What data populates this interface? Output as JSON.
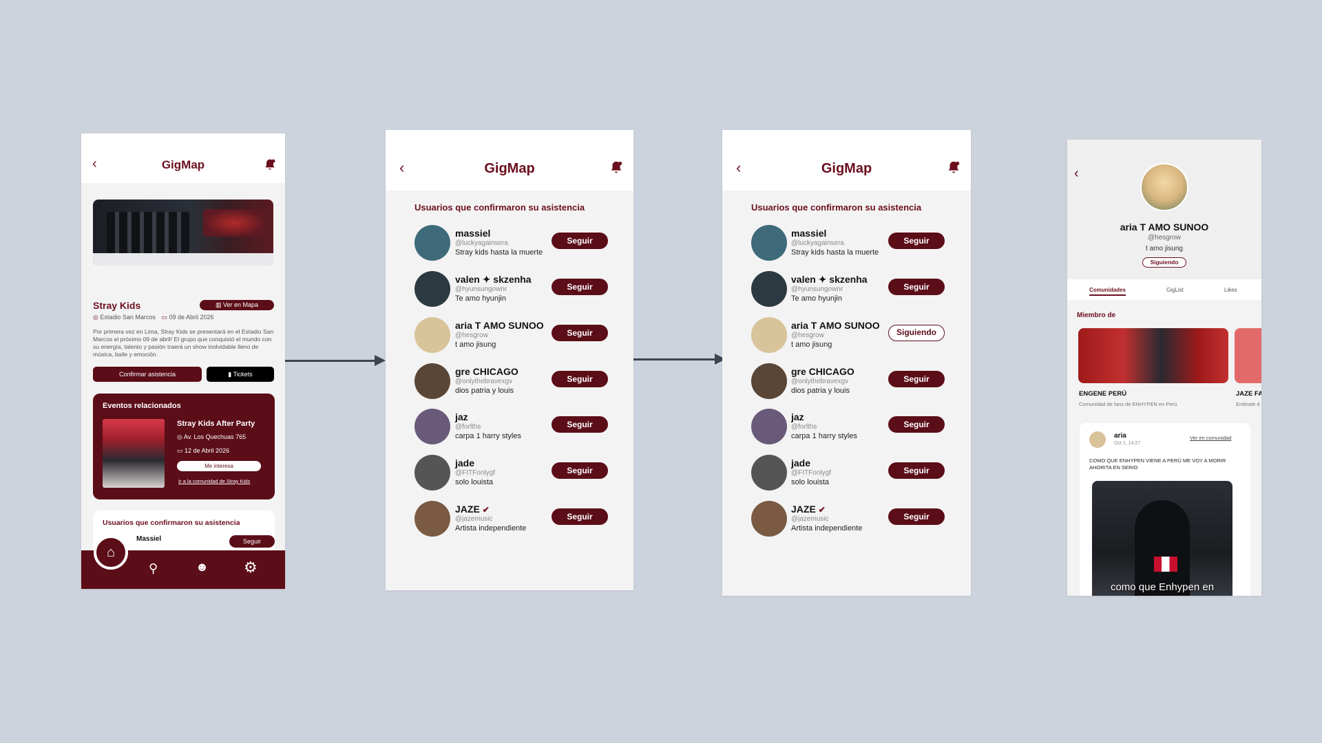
{
  "app": {
    "title": "GigMap"
  },
  "screen1": {
    "event_title": "Stray Kids",
    "map_button": "Ver en Mapa",
    "venue": "Estadio San Marcos",
    "date": "09 de Abril 2026",
    "description": "Por primera vez en Lima, Stray Kids se presentará en el Estadio San Marcos el próximo 09 de abril! El grupo que conquistó el mundo con su energía, talento y pasión traerá un show inolvidable lleno de música, baile y emoción.",
    "confirm_button": "Confirmar asistencia",
    "tickets_button": "Tickets",
    "related": {
      "heading": "Eventos relacionados",
      "title": "Stray Kids After Party",
      "address": "Av. Los Quechuas 765",
      "date": "12 de Abril 2026",
      "interest_button": "Me interesa",
      "community_link": "Ir a la comunidad de Stray Kids"
    },
    "attendees": {
      "heading": "Usuarios que confirmaron su asistencia",
      "first_name": "Massiel",
      "follow": "Seguir"
    }
  },
  "list_heading": "Usuarios que confirmaron su asistencia",
  "users": [
    {
      "name": "massiel",
      "handle": "@luckyagainsera",
      "bio": "Stray kids hasta la muerte",
      "color": "#3e6a7a"
    },
    {
      "name": "valen ✦ skzenha",
      "handle": "@hyunsungownr",
      "bio": "Te amo hyunjin",
      "color": "#2b3a40"
    },
    {
      "name": "aria T AMO SUNOO",
      "handle": "@hesgrow",
      "bio": "t amo jisung",
      "color": "#d9c39a"
    },
    {
      "name": "gre CHICAGO",
      "handle": "@onlythebravexgv",
      "bio": "dios patria y louis",
      "color": "#5a4636"
    },
    {
      "name": "jaz",
      "handle": "@forlths",
      "bio": "carpa 1 harry styles",
      "color": "#6a5a7a"
    },
    {
      "name": "jade",
      "handle": "@FITFonlygf",
      "bio": "solo louista",
      "color": "#555555"
    },
    {
      "name": "JAZE",
      "handle": "@jazemusic",
      "bio": "Artista independiente",
      "color": "#7a5a42"
    }
  ],
  "follow_label": "Seguir",
  "following_label": "Siguiendo",
  "profile": {
    "name": "aria T AMO SUNOO",
    "handle": "@hesgrow",
    "bio": "t amo jisung",
    "status_button": "Siguiendo",
    "tabs": [
      "Comunidades",
      "GigList",
      "Likes"
    ],
    "member_of": "Miembro de",
    "community1_name": "ENGENE PERÚ",
    "community1_desc": "Comunidad de fans de ENHYPEN en Perú",
    "community2_name": "JAZE FA",
    "community2_desc": "Entérate d",
    "post_user": "aria",
    "post_time": "Oct 1, 14:27",
    "post_link": "Ver en comunidad",
    "post_text": "COMO QUE ENHYPEN VIENE A PERÚ ME VOY A MORIR AHORITA EN SERIO",
    "post_caption": "como que Enhypen en"
  },
  "colors": {
    "brand": "#6b0f1e",
    "button": "#5b0d18",
    "background": "#cdd3dc"
  }
}
